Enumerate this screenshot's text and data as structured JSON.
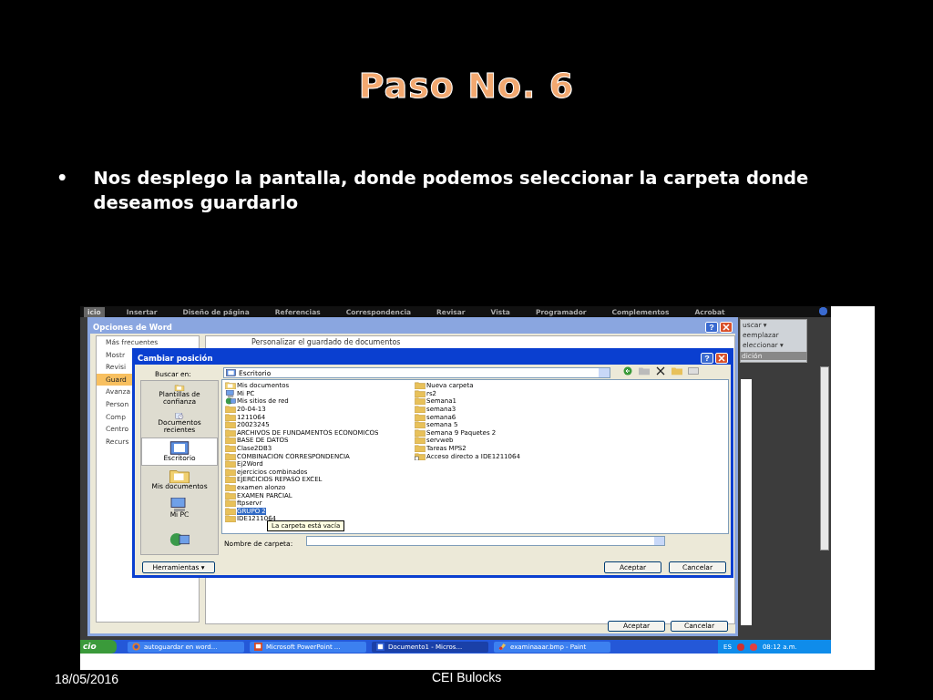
{
  "slide": {
    "title": "Paso No. 6",
    "bullets": [
      {
        "marker": "•",
        "text": "Nos desplego la pantalla, donde podemos seleccionar la carpeta donde deseamos guardarlo"
      }
    ],
    "date": "18/05/2016",
    "footer": "CEI Bulocks"
  },
  "screenshot": {
    "ribbon_tabs": [
      {
        "label": "icio",
        "selected": true
      },
      {
        "label": "Insertar",
        "selected": false
      },
      {
        "label": "Diseño de página",
        "selected": false
      },
      {
        "label": "Referencias",
        "selected": false
      },
      {
        "label": "Correspondencia",
        "selected": false
      },
      {
        "label": "Revisar",
        "selected": false
      },
      {
        "label": "Vista",
        "selected": false
      },
      {
        "label": "Programador",
        "selected": false
      },
      {
        "label": "Complementos",
        "selected": false
      },
      {
        "label": "Acrobat",
        "selected": false
      }
    ],
    "ribbon_group": {
      "items": [
        "uscar ▾",
        "eemplazar",
        "eleccionar ▾"
      ],
      "label": "dición"
    },
    "options_window": {
      "title": "Opciones de Word",
      "help": "?",
      "sidebar": [
        {
          "label": "Más frecuentes",
          "selected": false
        },
        {
          "label": "Mostr",
          "selected": false
        },
        {
          "label": "Revisi",
          "selected": false
        },
        {
          "label": "Guard",
          "selected": true
        },
        {
          "label": "Avanza",
          "selected": false
        },
        {
          "label": "Person",
          "selected": false
        },
        {
          "label": "Comp",
          "selected": false
        },
        {
          "label": "Centro",
          "selected": false
        },
        {
          "label": "Recurs",
          "selected": false
        }
      ],
      "heading": "Personalizar el guardado de documentos",
      "buttons": [
        "Aceptar",
        "Cancelar"
      ]
    },
    "dialog": {
      "title": "Cambiar posición",
      "help": "?",
      "look_in_label": "Buscar en:",
      "look_in_value": "Escritorio",
      "places": [
        {
          "kind": "templates",
          "label": "Plantillas de confianza",
          "selected": false
        },
        {
          "kind": "recent",
          "label": "Documentos recientes",
          "selected": false
        },
        {
          "kind": "desktop",
          "label": "Escritorio",
          "selected": true
        },
        {
          "kind": "documents",
          "label": "Mis documentos",
          "selected": false
        },
        {
          "kind": "computer",
          "label": "Mi PC",
          "selected": false
        },
        {
          "kind": "network",
          "selected": false
        }
      ],
      "files": [
        {
          "kind": "documents",
          "name": "Mis documentos",
          "selected": false
        },
        {
          "kind": "computer",
          "name": "Mi PC",
          "selected": false
        },
        {
          "kind": "network",
          "name": "Mis sitios de red",
          "selected": false
        },
        {
          "kind": "folder",
          "name": "20-04-13",
          "selected": false
        },
        {
          "kind": "folder",
          "name": "1211064",
          "selected": false
        },
        {
          "kind": "folder",
          "name": "20023245",
          "selected": false
        },
        {
          "kind": "folder",
          "name": "ARCHIVOS DE FUNDAMENTOS ECONOMICOS",
          "selected": false
        },
        {
          "kind": "folder",
          "name": "BASE DE DATOS",
          "selected": false
        },
        {
          "kind": "folder",
          "name": "Clase2DB3",
          "selected": false
        },
        {
          "kind": "folder",
          "name": "COMBINACION CORRESPONDENCIA",
          "selected": false
        },
        {
          "kind": "folder",
          "name": "Ej2Word",
          "selected": false
        },
        {
          "kind": "folder",
          "name": "ejercicios combinados",
          "selected": false
        },
        {
          "kind": "folder",
          "name": "EJERCICIOS REPASO EXCEL",
          "selected": false
        },
        {
          "kind": "folder",
          "name": "examen alonzo",
          "selected": false
        },
        {
          "kind": "folder",
          "name": "EXAMEN PARCIAL",
          "selected": false
        },
        {
          "kind": "folder",
          "name": "ftpservr",
          "selected": false
        },
        {
          "kind": "folder",
          "name": "GRUPO 2",
          "selected": true
        },
        {
          "kind": "folder",
          "name": "IDE1211064",
          "selected": false
        },
        {
          "kind": "folder",
          "name": "Nueva carpeta",
          "selected": false
        },
        {
          "kind": "folder",
          "name": "rs2",
          "selected": false
        },
        {
          "kind": "folder",
          "name": "Semana1",
          "selected": false
        },
        {
          "kind": "folder",
          "name": "semana3",
          "selected": false
        },
        {
          "kind": "folder",
          "name": "semana6",
          "selected": false
        },
        {
          "kind": "folder",
          "name": "semana 5",
          "selected": false
        },
        {
          "kind": "folder",
          "name": "Semana 9 Paquetes 2",
          "selected": false
        },
        {
          "kind": "folder",
          "name": "servweb",
          "selected": false
        },
        {
          "kind": "folder",
          "name": "Tareas MPS2",
          "selected": false
        },
        {
          "kind": "shortcut",
          "name": "Acceso directo a IDE1211064",
          "selected": false
        }
      ],
      "tooltip": "La carpeta está vacía",
      "name_label": "Nombre de carpeta:",
      "tools_button": "Herramientas ▾",
      "buttons": [
        "Aceptar",
        "Cancelar"
      ]
    },
    "taskbar": {
      "start": "cio",
      "tasks": [
        {
          "kind": "browser",
          "label": "autoguardar en word...",
          "selected": false
        },
        {
          "kind": "powerpoint",
          "label": "Microsoft PowerPoint ...",
          "selected": false
        },
        {
          "kind": "word",
          "label": "Documento1 - Micros...",
          "selected": true
        },
        {
          "kind": "paint",
          "label": "examinaaar.bmp - Paint",
          "selected": false
        }
      ],
      "language": "ES",
      "clock": "08:12 a.m."
    }
  }
}
